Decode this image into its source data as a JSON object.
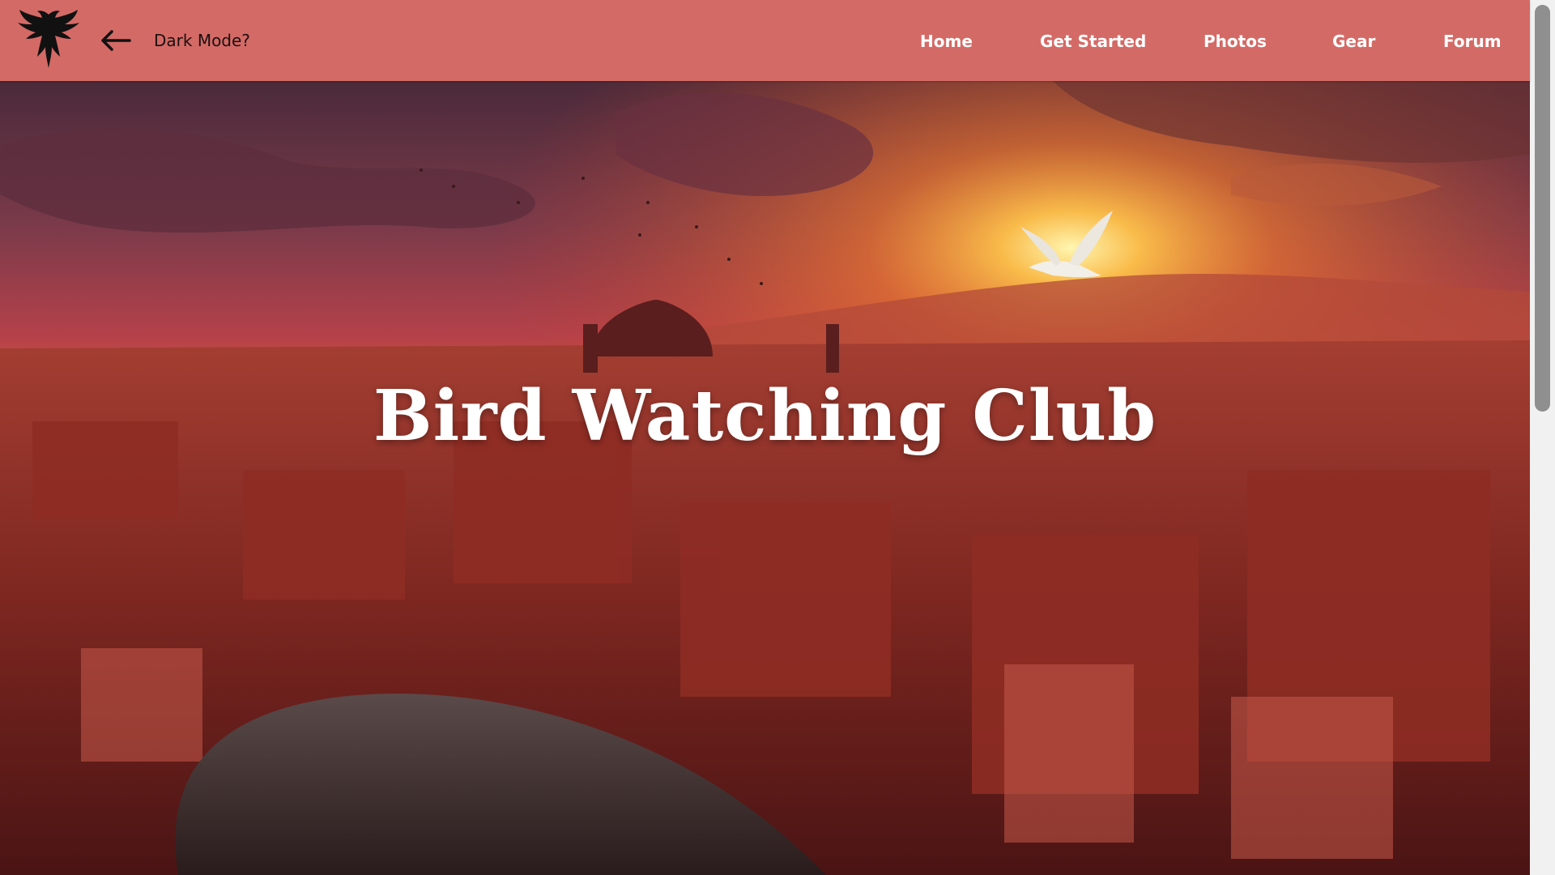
{
  "header": {
    "logo_icon": "eagle-silhouette-icon",
    "back_icon": "arrow-left-icon",
    "dark_mode_label": "Dark Mode?",
    "nav": {
      "home": "Home",
      "get_started": "Get Started",
      "photos": "Photos",
      "gear": "Gear",
      "forum": "Forum"
    },
    "background_color": "#d46a66"
  },
  "hero": {
    "title": "Bird Watching Club",
    "image_subject": "sunset over a city with a white dove flying"
  }
}
